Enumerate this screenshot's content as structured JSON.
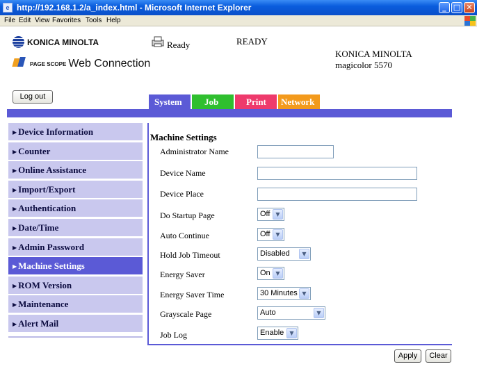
{
  "window": {
    "title": "http://192.168.1.2/a_index.html - Microsoft Internet Explorer"
  },
  "menu": [
    "File",
    "Edit",
    "View",
    "Favorites",
    "Tools",
    "Help"
  ],
  "header": {
    "logo_brand": "KONICA MINOLTA",
    "logo_pagescope": "PAGE SCOPE",
    "logo_product": "Web Connection",
    "status": "Ready",
    "ready": "READY",
    "brand": "KONICA MINOLTA",
    "model": "magicolor 5570",
    "logout": "Log out"
  },
  "tabs": [
    {
      "label": "System",
      "color": "#5b5ad6"
    },
    {
      "label": "Job",
      "color": "#2fbf2f"
    },
    {
      "label": "Print",
      "color": "#ee3a6c"
    },
    {
      "label": "Network",
      "color": "#f39a1c"
    }
  ],
  "sidebar": {
    "items": [
      "Device Information",
      "Counter",
      "Online Assistance",
      "Import/Export",
      "Authentication",
      "Date/Time",
      "Admin Password",
      "Machine Settings",
      "ROM Version",
      "Maintenance",
      "Alert Mail"
    ],
    "active": "Machine Settings"
  },
  "form": {
    "title": "Machine Settings",
    "fields": {
      "admin_name": {
        "label": "Administrator Name",
        "value": ""
      },
      "device_name": {
        "label": "Device Name",
        "value": ""
      },
      "device_place": {
        "label": "Device Place",
        "value": ""
      },
      "startup_page": {
        "label": "Do Startup Page",
        "value": "Off"
      },
      "auto_continue": {
        "label": "Auto Continue",
        "value": "Off"
      },
      "hold_job_timeout": {
        "label": "Hold Job Timeout",
        "value": "Disabled"
      },
      "energy_saver": {
        "label": "Energy Saver",
        "value": "On"
      },
      "energy_saver_time": {
        "label": "Energy Saver Time",
        "value": "30 Minutes"
      },
      "grayscale_page": {
        "label": "Grayscale Page",
        "value": "Auto"
      },
      "job_log": {
        "label": "Job Log",
        "value": "Enable"
      }
    }
  },
  "buttons": {
    "apply": "Apply",
    "clear": "Clear"
  }
}
